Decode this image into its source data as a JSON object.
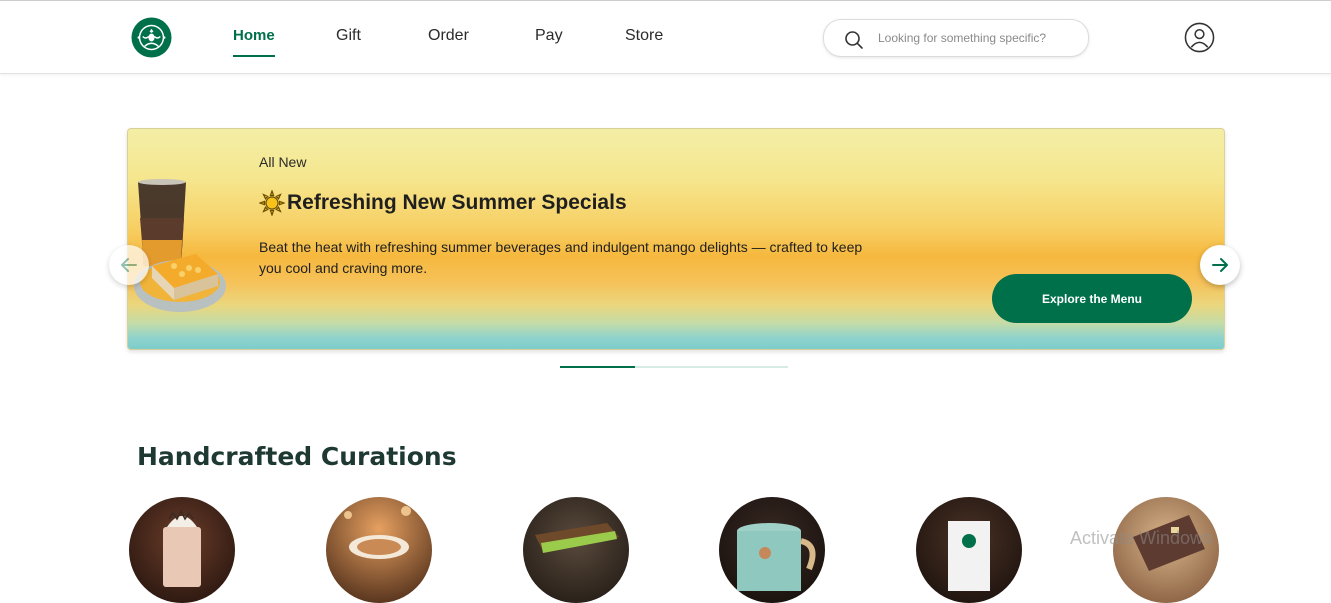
{
  "header": {
    "nav": [
      {
        "label": "Home",
        "active": true
      },
      {
        "label": "Gift",
        "active": false
      },
      {
        "label": "Order",
        "active": false
      },
      {
        "label": "Pay",
        "active": false
      },
      {
        "label": "Store",
        "active": false
      }
    ],
    "search": {
      "placeholder": "Looking for something specific?",
      "value": ""
    },
    "icons": [
      "starbucks-logo",
      "search-icon",
      "user-icon"
    ]
  },
  "banner": {
    "eyebrow": "All New",
    "headline": "Refreshing New Summer Specials",
    "description": "Beat the heat with refreshing summer beverages and indulgent mango delights — crafted to keep you cool and craving more.",
    "cta_label": "Explore the Menu",
    "progress": 0.33
  },
  "curations": {
    "title": "Handcrafted Curations",
    "items": [
      "frappuccino",
      "latte",
      "sandwich",
      "mug",
      "coffee-beans",
      "gift-card"
    ]
  },
  "overlay": {
    "watermark": "Activate Windows"
  },
  "colors": {
    "brand_green": "#00704a",
    "heading_dark": "#1e3932"
  }
}
